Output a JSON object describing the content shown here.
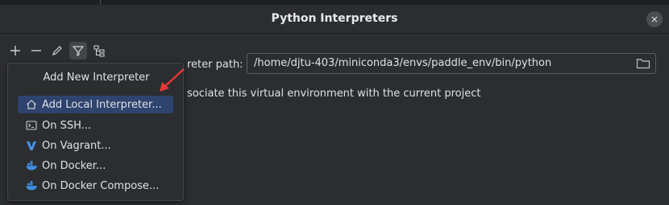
{
  "dialog": {
    "title": "Python Interpreters",
    "close_label": "×"
  },
  "toolbar": {
    "buttons": [
      {
        "icon": "plus-icon"
      },
      {
        "icon": "minus-icon"
      },
      {
        "icon": "pencil-icon"
      },
      {
        "icon": "filter-icon",
        "active": true
      },
      {
        "icon": "tree-icon"
      }
    ]
  },
  "form": {
    "interpreter_path_label": "reter path:",
    "interpreter_path_value": "/home/djtu-403/miniconda3/envs/paddle_env/bin/python",
    "associate_text": "sociate this virtual environment with the current project"
  },
  "popup": {
    "header": "Add New Interpreter",
    "items": [
      {
        "label": "Add Local Interpreter...",
        "icon": "home-icon",
        "selected": true
      },
      {
        "label": "On SSH...",
        "icon": "terminal-icon"
      },
      {
        "label": "On Vagrant...",
        "icon": "vagrant-icon"
      },
      {
        "label": "On Docker...",
        "icon": "docker-icon"
      },
      {
        "label": "On Docker Compose...",
        "icon": "docker-compose-icon"
      }
    ]
  },
  "colors": {
    "background": "#2b2d30",
    "selected_item": "#2e436e",
    "annotation_arrow": "#e53935",
    "docker_blue": "#3f8fe0",
    "vagrant_blue": "#4a90e2"
  }
}
